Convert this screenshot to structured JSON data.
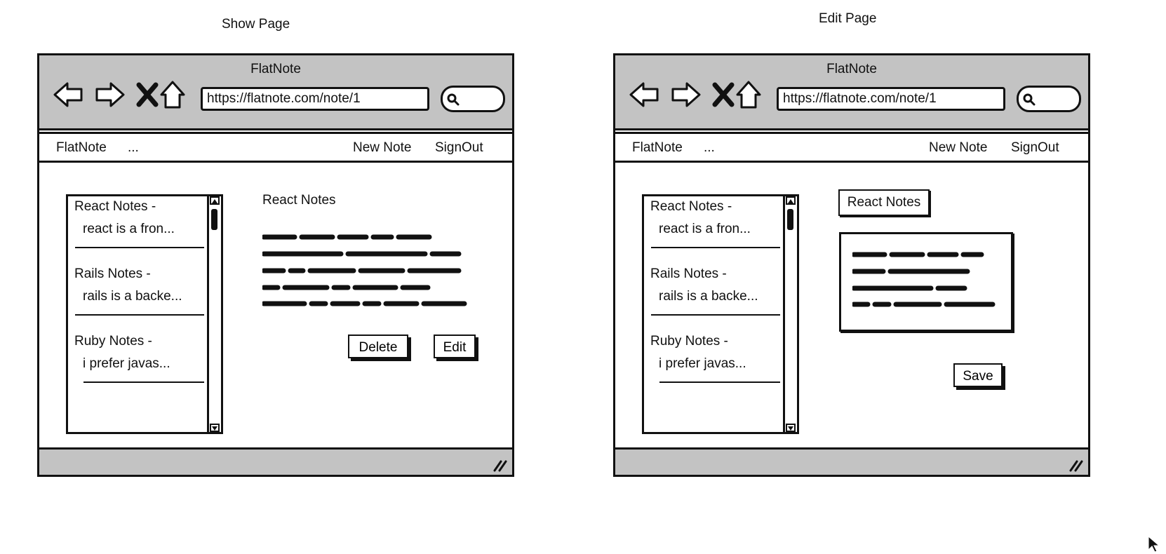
{
  "show_page": {
    "caption": "Show Page",
    "window_title": "FlatNote",
    "url": "https://flatnote.com/note/1",
    "menu": {
      "brand": "FlatNote",
      "more": "...",
      "new_note": "New Note",
      "sign_out": "SignOut"
    },
    "notes_list": [
      {
        "title": "React Notes -",
        "preview": "react is a fron..."
      },
      {
        "title": "Rails Notes -",
        "preview": "rails is a backe..."
      },
      {
        "title": "Ruby Notes -",
        "preview": "i prefer javas..."
      }
    ],
    "note_title": "React Notes",
    "delete_label": "Delete",
    "edit_label": "Edit"
  },
  "edit_page": {
    "caption": "Edit Page",
    "window_title": "FlatNote",
    "url": "https://flatnote.com/note/1",
    "menu": {
      "brand": "FlatNote",
      "more": "...",
      "new_note": "New Note",
      "sign_out": "SignOut"
    },
    "notes_list": [
      {
        "title": "React Notes -",
        "preview": "react is a fron..."
      },
      {
        "title": "Rails Notes -",
        "preview": "rails is a backe..."
      },
      {
        "title": "Ruby Notes -",
        "preview": "i prefer javas..."
      }
    ],
    "note_title_value": "React Notes",
    "save_label": "Save"
  },
  "icons": {
    "back": "back-arrow-icon",
    "forward": "forward-arrow-icon",
    "stop": "close-x-icon",
    "home": "home-icon",
    "search": "search-icon",
    "resize": "resize-grip-icon",
    "cursor": "mouse-pointer-icon"
  },
  "colors": {
    "chrome": "#c3c3c3",
    "ink": "#111111",
    "background": "#ffffff"
  }
}
